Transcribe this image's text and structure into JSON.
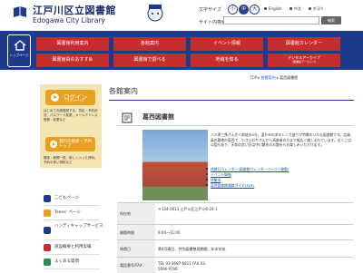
{
  "header": {
    "logo_ja": "江戸川区立図書館",
    "logo_en": "Edogawa City Library",
    "font_size_label": "文字サイズ",
    "font_sizes": [
      "小",
      "中",
      "大"
    ],
    "languages": [
      "English",
      "中文",
      "한국어"
    ],
    "search_label": "サイト内検索",
    "search_placeholder": "",
    "search_button": "検索"
  },
  "nav": {
    "home_label": "トップページ",
    "items": [
      "図書館利用案内",
      "各館案内",
      "イベント情報",
      "図書館カレンダー",
      "図書館員のおすすめ",
      "図書館で調べる",
      "地域を知る",
      "デジタルアーカイブ"
    ],
    "sub_label": "(図書館アーカイブ)"
  },
  "breadcrumb": [
    "TOP",
    "各館案内",
    "葛西図書館"
  ],
  "sidebar": {
    "login_label": "ログイン",
    "login_sub": "(マイページ)",
    "login_text": "はじめて利用登録する、貸出・予約状況、パスワード変更、メールアドレス登録・変更など",
    "reserve_label": "資料の検索・予約トップ",
    "reserve_text": "雑誌・新聞一覧、新しく入った資料、予約の多い資料など",
    "items": [
      "こどもページ",
      "Teens' ページ",
      "ハンディキャップサービス",
      "施設概要と利用実績",
      "よくある質問"
    ]
  },
  "main": {
    "page_title": "各館案内",
    "section_title": "葛西図書館",
    "description": "バス停三角さんかく前徒歩3分。温かみのあるレンガ造りが特徴のいわな図書館です。広幅員の敷地の東西で、小さいおやさんから高齢者の方まで幅広く親しまれています。近くには公園もあり、天気の良い日は中川散歩のお散歩もお楽しみいただけます。",
    "links": [
      "休館日カレンダー(図書館カレンダーページへ移動)",
      "イベント情報",
      "特集本",
      "葛西図書館開館ガイド(PDF)"
    ],
    "info": [
      {
        "label": "所在地",
        "value": "〒134-0013 江戸川区江戸川6-24-1"
      },
      {
        "label": "開館時間",
        "value": "9:00〜21:00"
      },
      {
        "label": "休館日",
        "value": "第4月曜日、特別図書整理期間、年末年始"
      },
      {
        "label": "電話番号/FAX",
        "value": "TEL 03-3687-6811 FAX 03-5696-9706"
      }
    ]
  },
  "colors": {
    "brand_blue": "#1e3a8a",
    "nav_red": "#c62d2d",
    "login_orange": "#e8a020",
    "sidebar_bg": "#f3e6b3"
  }
}
